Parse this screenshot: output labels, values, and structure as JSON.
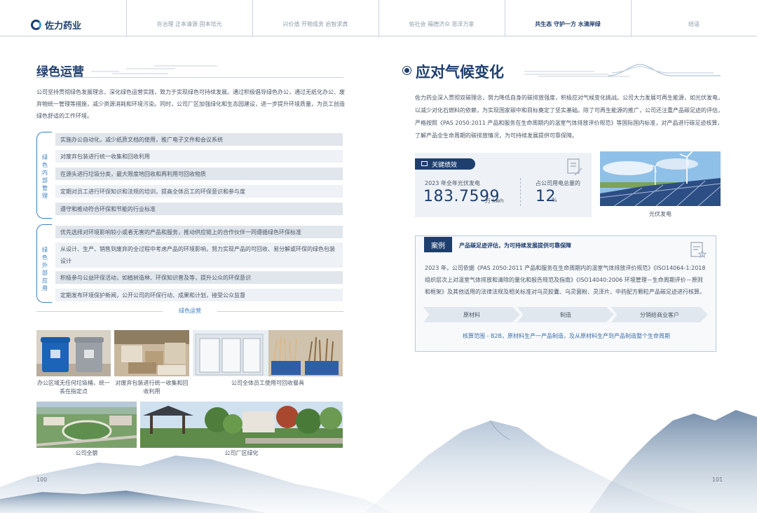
{
  "header": {
    "logo_text": "佐力药业",
    "nav": [
      {
        "label": "夯治理 正本清源 固本培元",
        "active": false
      },
      {
        "label": "兴价值 开物成务 启智求真",
        "active": false
      },
      {
        "label": "佑社会 福德济众 恩泽万家",
        "active": false
      },
      {
        "label": "共生态 守护一方 水清岸绿",
        "active": true
      },
      {
        "label": "结语",
        "active": false
      }
    ]
  },
  "left": {
    "title": "绿色运营",
    "intro": "公司坚持贯彻绿色发展理念，深化绿色运营实践，致力于实现绿色可持续发展。通过积极倡导绿色办公，通过无纸化办公、废弃物统一管理等措施，减少资源消耗和环境污染。同时，公司厂区加强绿化和生态园建设，进一步提升环境质量，为员工创造绿色舒适的工作环境。",
    "group1_label": "绿色内部管理",
    "group1_items": [
      "实施办公自动化，减少纸质文档的使用，推广电子文件和会议系统",
      "对废弃包装进行统一收集和回收利用",
      "在源头进行垃圾分类，最大限度地回收和再利用可回收物质",
      "定期对员工进行环保知识和法规的培训，提高全体员工的环保意识和参与度",
      "遵守和推动符合环保和节能的行业标准"
    ],
    "group2_label": "绿色外部应用",
    "group2_items": [
      "优先选择对环境影响较小或者无害的产品和服务，推动供应链上的合作伙伴一同遵循绿色环保标准",
      "从设计、生产、销售到废弃的全过程中考虑产品的环境影响，努力实现产品的可回收、易分解或环保的绿色包装设计",
      "积极参与公益环保活动，如植树造林、环保知识普及等，提升公众的环保意识",
      "定期发布环境保护新闻，公开公司的环保行动、成果和计划，接受公众监督"
    ],
    "section_caption": "绿色运营",
    "photos": [
      {
        "caption": "办公区域无任何垃圾桶，统一丢在指定点"
      },
      {
        "caption": "对废弃包装进行统一收集和回收利用"
      },
      {
        "caption": "公司全体员工使用可回收餐具"
      },
      {
        "caption": "公司全貌"
      },
      {
        "caption": "公司厂区绿化"
      }
    ],
    "page_number": "100"
  },
  "right": {
    "title": "应对气候变化",
    "intro": "佐力药业深入贯彻双碳理念，努力降低自身的碳排放强度，积极应对气候变化挑战。公司大力发展可再生能源，如光伏发电，以减少对化石燃料的依赖，为实现国家碳中和目标奠定了坚实基础。除了可再生能源的推广，公司还注重产品碳足迹的评估，严格按照《PAS 2050:2011 产品和服务在生命周期内的温室气体排放评价规范》等国际国内标准，对产品进行碳足迹核算，了解产品全生命周期的碳排放情况，为可持续发展提供可靠保障。",
    "kpi": {
      "tag": "关键绩效",
      "pv_label": "2023 年全年光伏发电",
      "pv_value": "183.7599",
      "pv_unit": "万 kwh",
      "share_label": "占公司用电总量的",
      "share_value": "12",
      "share_unit": "%"
    },
    "photo_caption": "光伏发电",
    "case": {
      "tag": "案例",
      "title": "产品碳足迹评估，为可持续发展提供可靠保障",
      "body": "2023 年，公司依据《PAS 2050:2011 产品和服务在生命周期内的温室气体排放评价规范》《ISO14064-1:2018 组织层次上对温室气体排放和清除的量化和报告规范及指南》《ISO14040:2006 环境管理－生命周期评价－原则和框架》及其他适用的法律法规及相关标准对乌灵胶囊、乌灵菌粉、灵泽片、中药配方颗粒产品碳足迹进行核算。",
      "steps": [
        "原材料",
        "制造",
        "分销给商业客户"
      ],
      "note": "核算范围 - B2B，原材料生产一产品制造，及从原材料生产到产品制造整个生命周期"
    },
    "page_number": "101"
  }
}
